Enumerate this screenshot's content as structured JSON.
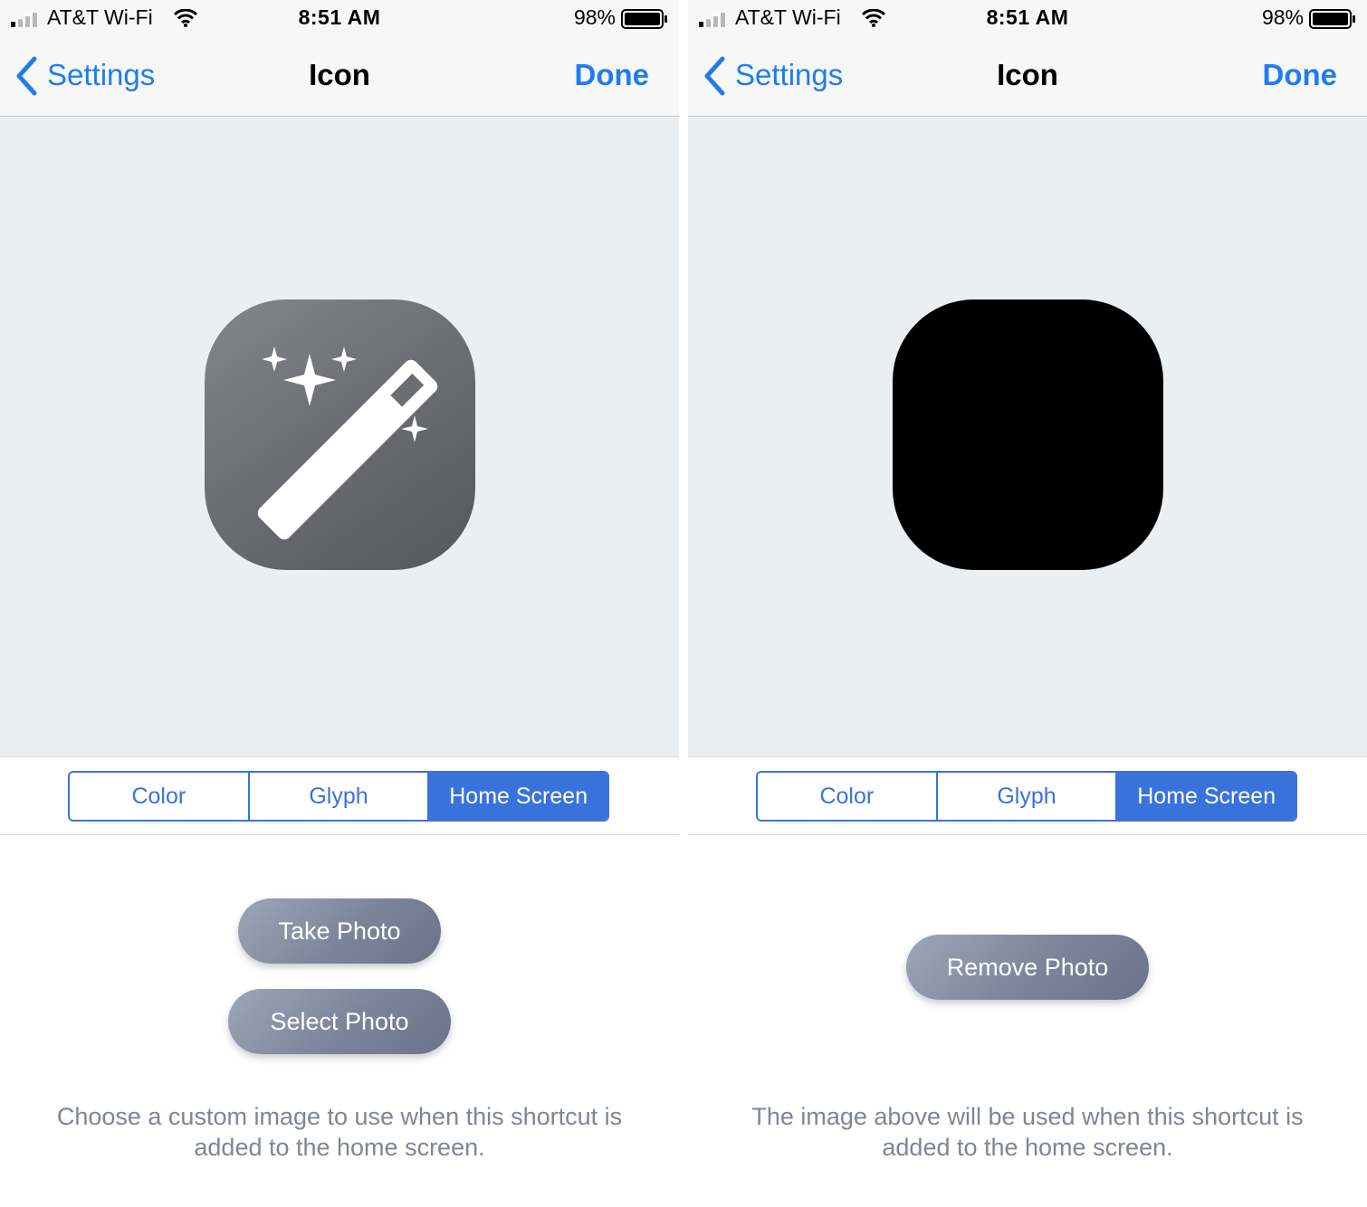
{
  "screens": [
    {
      "status_bar": {
        "carrier": "AT&T Wi-Fi",
        "time": "8:51 AM",
        "battery": "98%"
      },
      "nav": {
        "back_label": "Settings",
        "title": "Icon",
        "done_label": "Done"
      },
      "preview": {
        "icon": "magic-wand-icon",
        "icon_color": "#6d6f74"
      },
      "segments": [
        {
          "label": "Color",
          "selected": false
        },
        {
          "label": "Glyph",
          "selected": false
        },
        {
          "label": "Home Screen",
          "selected": true
        }
      ],
      "buttons": {
        "take_photo": "Take Photo",
        "select_photo": "Select Photo"
      },
      "caption": "Choose a custom image to use when this shortcut is added to the home screen."
    },
    {
      "status_bar": {
        "carrier": "AT&T Wi-Fi",
        "time": "8:51 AM",
        "battery": "98%"
      },
      "nav": {
        "back_label": "Settings",
        "title": "Icon",
        "done_label": "Done"
      },
      "preview": {
        "icon": "custom-photo",
        "icon_color": "#000000"
      },
      "segments": [
        {
          "label": "Color",
          "selected": false
        },
        {
          "label": "Glyph",
          "selected": false
        },
        {
          "label": "Home Screen",
          "selected": true
        }
      ],
      "buttons": {
        "remove_photo": "Remove Photo"
      },
      "caption": "The image above will be used when this shortcut is added to the home screen."
    }
  ],
  "colors": {
    "accent": "#1f7cef",
    "segment_accent": "#3a72dc",
    "preview_bg": "#eceff2",
    "caption": "#7f8596"
  }
}
